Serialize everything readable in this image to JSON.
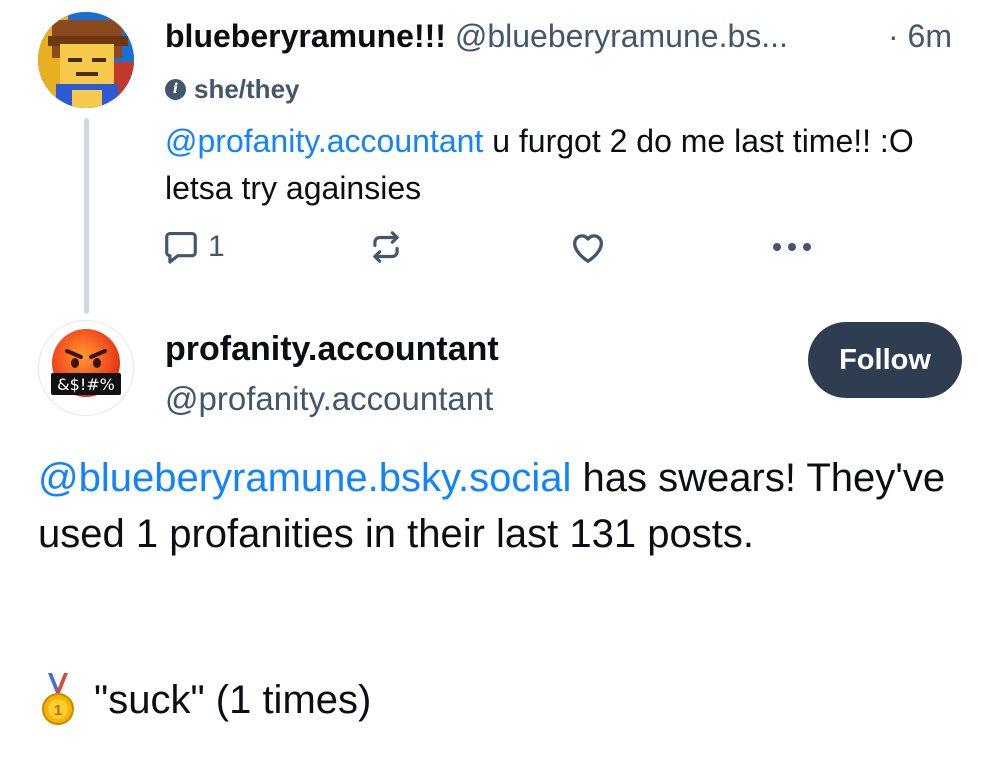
{
  "reply": {
    "display_name": "blueberyramune!!!",
    "handle": "@blueberyramune.bs...",
    "timestamp": "· 6m",
    "pronouns": "she/they",
    "mention": "@profanity.accountant",
    "text": " u furgot 2 do me last time!! :O    letsa try againsies",
    "reply_count": "1",
    "icons": [
      "reply-icon",
      "repost-icon",
      "like-icon",
      "more-icon"
    ]
  },
  "post": {
    "display_name": "profanity.accountant",
    "handle": "@profanity.accountant",
    "follow_label": "Follow",
    "avatar_label": "&$!#%",
    "mention": "@blueberyramune.bsky.social",
    "text": " has swears! They've used 1 profanities in their last 131 posts.",
    "medal": "🥇",
    "ranking": "\"suck\" (1 times)"
  },
  "colors": {
    "link": "#1083fe",
    "secondary_text": "#42576c",
    "follow_button": "#2e3d4f",
    "thread_line": "#d4d9de"
  }
}
